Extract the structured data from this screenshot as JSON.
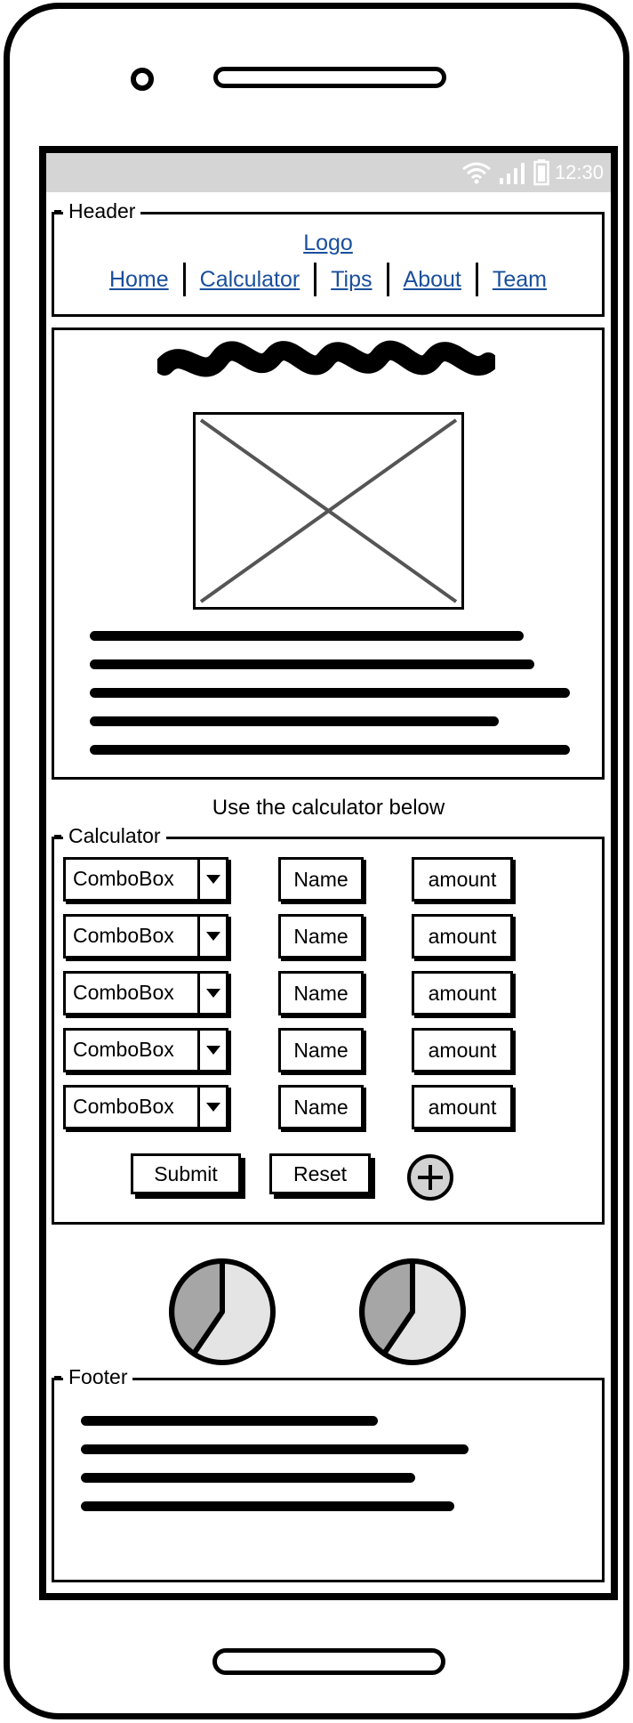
{
  "status_bar": {
    "time": "12:30"
  },
  "header": {
    "label": "Header",
    "logo": "Logo",
    "nav": [
      "Home",
      "Calculator",
      "Tips",
      "About",
      "Team"
    ]
  },
  "content": {
    "image_placeholder": "image-placeholder-icon"
  },
  "instruction": "Use the calculator below",
  "calculator": {
    "label": "Calculator",
    "rows": [
      {
        "combo": "ComboBox",
        "name": "Name",
        "amount": "amount"
      },
      {
        "combo": "ComboBox",
        "name": "Name",
        "amount": "amount"
      },
      {
        "combo": "ComboBox",
        "name": "Name",
        "amount": "amount"
      },
      {
        "combo": "ComboBox",
        "name": "Name",
        "amount": "amount"
      },
      {
        "combo": "ComboBox",
        "name": "Name",
        "amount": "amount"
      }
    ],
    "submit_label": "Submit",
    "reset_label": "Reset"
  },
  "footer": {
    "label": "Footer"
  },
  "colors": {
    "link": "#1a4f9c",
    "statusbar": "#d5d5d5",
    "pie_dark": "#a6a6a6",
    "pie_light": "#e4e4e4"
  }
}
